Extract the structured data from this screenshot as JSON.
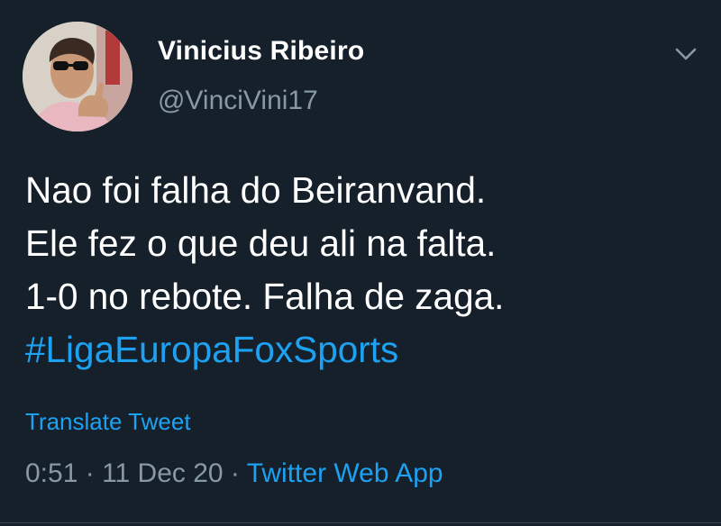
{
  "user": {
    "display_name": "Vinicius Ribeiro",
    "handle": "@VinciVini17"
  },
  "menu_icon": "chevron-down-icon",
  "tweet": {
    "lines": [
      "Nao foi falha do Beiranvand.",
      "Ele fez o que deu ali na falta.",
      "1-0 no rebote. Falha de zaga."
    ],
    "hashtag": "#LigaEuropaFoxSports"
  },
  "translate_label": "Translate Tweet",
  "meta": {
    "time": "0:51",
    "separator": " · ",
    "date": "11 Dec 20",
    "source": "Twitter Web App"
  },
  "colors": {
    "background": "#15202b",
    "text": "#ffffff",
    "secondary": "#8899a6",
    "accent": "#1da1f2"
  }
}
